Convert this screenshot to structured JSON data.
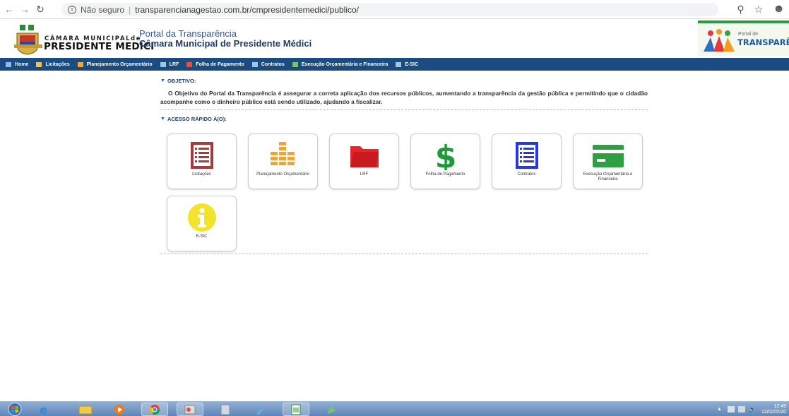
{
  "browser": {
    "security_label": "Não seguro",
    "url": "transparencianagestao.com.br/cmpresidentemedici/publico/"
  },
  "header": {
    "logo_line1": "CÂMARA MUNICIPALde",
    "logo_line2": "PRESIDENTE MEDICI",
    "portal_title": "Portal da Transparência",
    "portal_subtitle": "Câmara Municipal de Presidente Médici",
    "transp_small": "Portal de",
    "transp_big": "TRANSPARÊNCIA"
  },
  "nav": {
    "items": [
      {
        "label": "Home",
        "color": "#8fb8e8"
      },
      {
        "label": "Licitações",
        "color": "#e8c25a"
      },
      {
        "label": "Planejamento Orçamentário",
        "color": "#f0a431"
      },
      {
        "label": "LRF",
        "color": "#9cc6ea"
      },
      {
        "label": "Folha de Pagamento",
        "color": "#d9534f"
      },
      {
        "label": "Contratos",
        "color": "#9cc6ea"
      },
      {
        "label": "Execução Orçamentária e Financeira",
        "color": "#7bc36a"
      },
      {
        "label": "E-SIC",
        "color": "#9cc6ea"
      }
    ]
  },
  "objective": {
    "heading": "OBJETIVO:",
    "text": "O Objetivo do Portal da Transparência é assegurar a correta aplicação dos recursos públicos, aumentando a transparência da gestão pública e permitindo que o cidadão acompanhe como o dinheiro público está sendo utilizado, ajudando a fiscalizar."
  },
  "quick_access": {
    "heading": "ACESSO RÁPIDO À(O):",
    "tiles": [
      {
        "label": "Licitações",
        "icon": "list-icon",
        "color": "#a83a3a"
      },
      {
        "label": "Planejamento Orçamentário",
        "icon": "bars-icon",
        "color": "#f0a431"
      },
      {
        "label": "LRF",
        "icon": "folder-icon",
        "color": "#e8242b"
      },
      {
        "label": "Folha de Pagamento",
        "icon": "dollar-icon",
        "color": "#1d9b3a"
      },
      {
        "label": "Contratos",
        "icon": "document-icon",
        "color": "#2838e0"
      },
      {
        "label": "Execução Orçamentária e Financeira",
        "icon": "card-icon",
        "color": "#2fa042"
      },
      {
        "label": "E-SIC",
        "icon": "info-icon",
        "color": "#f2e42a"
      }
    ]
  },
  "taskbar": {
    "time": "12:49",
    "date": "12/02/2020"
  }
}
